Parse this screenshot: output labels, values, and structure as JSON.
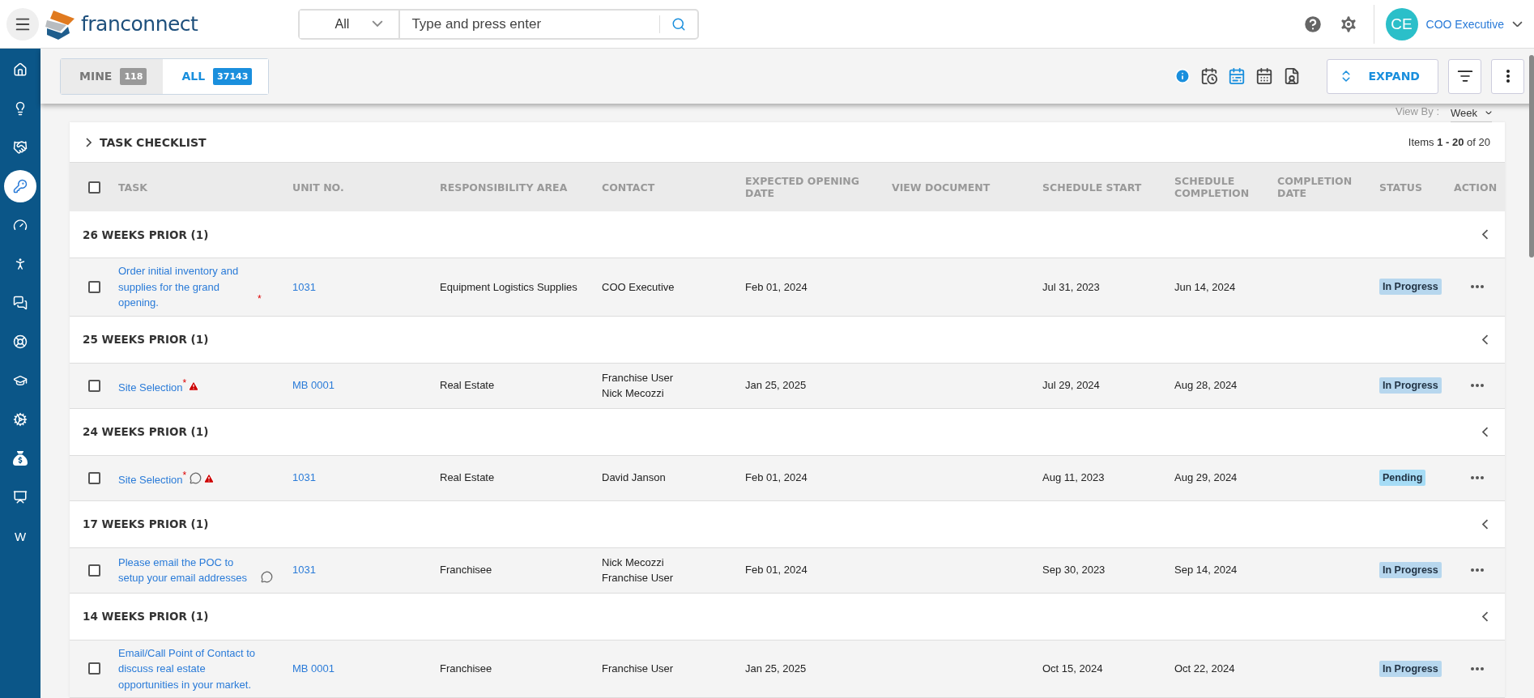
{
  "header": {
    "brand": "franconnect",
    "search": {
      "scope": "All",
      "placeholder": "Type and press enter"
    },
    "user": {
      "initials": "CE",
      "name": "COO Executive"
    }
  },
  "sidebar": {
    "items": [
      {
        "kind": "home",
        "selected": false
      },
      {
        "kind": "idea",
        "selected": false
      },
      {
        "kind": "handshake",
        "selected": false
      },
      {
        "kind": "key",
        "selected": true
      },
      {
        "kind": "gauge",
        "selected": false
      },
      {
        "kind": "person",
        "selected": false
      },
      {
        "kind": "chat",
        "selected": false
      },
      {
        "kind": "lifebuoy",
        "selected": false
      },
      {
        "kind": "graduation",
        "selected": false
      },
      {
        "kind": "cog",
        "selected": false
      },
      {
        "kind": "money",
        "selected": false
      },
      {
        "kind": "presentation",
        "selected": false
      },
      {
        "kind": "letter",
        "label": "W",
        "selected": false
      }
    ]
  },
  "toolbar": {
    "filters": [
      {
        "label": "MINE",
        "count": "118",
        "selected": false
      },
      {
        "label": "ALL",
        "count": "37143",
        "selected": true
      }
    ],
    "views": [
      {
        "kind": "timeline",
        "selected": false
      },
      {
        "kind": "list",
        "selected": true
      },
      {
        "kind": "notes",
        "selected": false
      },
      {
        "kind": "people",
        "selected": false
      }
    ],
    "expand": "EXPAND"
  },
  "view_by": {
    "label": "View By :",
    "value": "Week"
  },
  "table": {
    "title": "TASK CHECKLIST",
    "summary": "Items **1 - 20** of 20",
    "select_all_checked": false,
    "columns": [
      "TASK",
      "UNIT NO.",
      "RESPONSIBILITY AREA",
      "CONTACT",
      "EXPECTED OPENING DATE",
      "VIEW DOCUMENT",
      "SCHEDULE START",
      "SCHEDULE COMPLETION",
      "COMPLETION DATE",
      "STATUS",
      "ACTION"
    ],
    "groups": [
      {
        "title": "26 WEEKS PRIOR (1)",
        "expanded": true,
        "rows": [
          {
            "checked": false,
            "task": "Order initial inventory and supplies for the grand opening.",
            "required_mark": "*",
            "comment": false,
            "warning": false,
            "unit": "1031",
            "area": "Equipment Logistics Supplies",
            "contacts": [
              "COO Executive"
            ],
            "expected_opening": "Feb 01, 2024",
            "schedule_start": "Jul 31, 2023",
            "schedule_completion": "Jun 14, 2024",
            "status": "In Progress",
            "color": "#b7d7ee"
          }
        ]
      },
      {
        "title": "25 WEEKS PRIOR (1)",
        "expanded": true,
        "rows": [
          {
            "checked": false,
            "task": "Site Selection",
            "required_mark": "*",
            "comment": false,
            "warning": true,
            "unit": "MB 0001",
            "area": "Real Estate",
            "contacts": [
              "Franchise User",
              "Nick Mecozzi"
            ],
            "expected_opening": "Jan 25, 2025",
            "schedule_start": "Jul 29, 2024",
            "schedule_completion": "Aug 28, 2024",
            "status": "In Progress",
            "color": "#b7d7ee"
          }
        ]
      },
      {
        "title": "24 WEEKS PRIOR (1)",
        "expanded": true,
        "rows": [
          {
            "checked": false,
            "task": "Site Selection",
            "required_mark": "*",
            "comment": true,
            "warning": true,
            "unit": "1031",
            "area": "Real Estate",
            "contacts": [
              "David Janson"
            ],
            "expected_opening": "Feb 01, 2024",
            "schedule_start": "Aug 11, 2023",
            "schedule_completion": "Aug 29, 2024",
            "status": "Pending",
            "color": "#a6dcf6"
          }
        ]
      },
      {
        "title": "17 WEEKS PRIOR (1)",
        "expanded": true,
        "rows": [
          {
            "checked": false,
            "task": "Please email the POC to setup your email addresses",
            "comment": true,
            "warning": false,
            "unit": "1031",
            "area": "Franchisee",
            "contacts": [
              "Nick Mecozzi",
              "Franchise User"
            ],
            "expected_opening": "Feb 01, 2024",
            "schedule_start": "Sep 30, 2023",
            "schedule_completion": "Sep 14, 2024",
            "status": "In Progress",
            "color": "#b7d7ee"
          }
        ]
      },
      {
        "title": "14 WEEKS PRIOR (1)",
        "expanded": true,
        "rows": [
          {
            "checked": false,
            "task": "Email/Call Point of Contact to discuss real estate opportunities in your market.",
            "comment": false,
            "warning": false,
            "unit": "MB 0001",
            "area": "Franchisee",
            "contacts": [
              "Franchise User"
            ],
            "expected_opening": "Jan 25, 2025",
            "schedule_start": "Oct 15, 2024",
            "schedule_completion": "Oct 22, 2024",
            "status": "In Progress",
            "color": "#b7d7ee"
          }
        ]
      }
    ]
  }
}
